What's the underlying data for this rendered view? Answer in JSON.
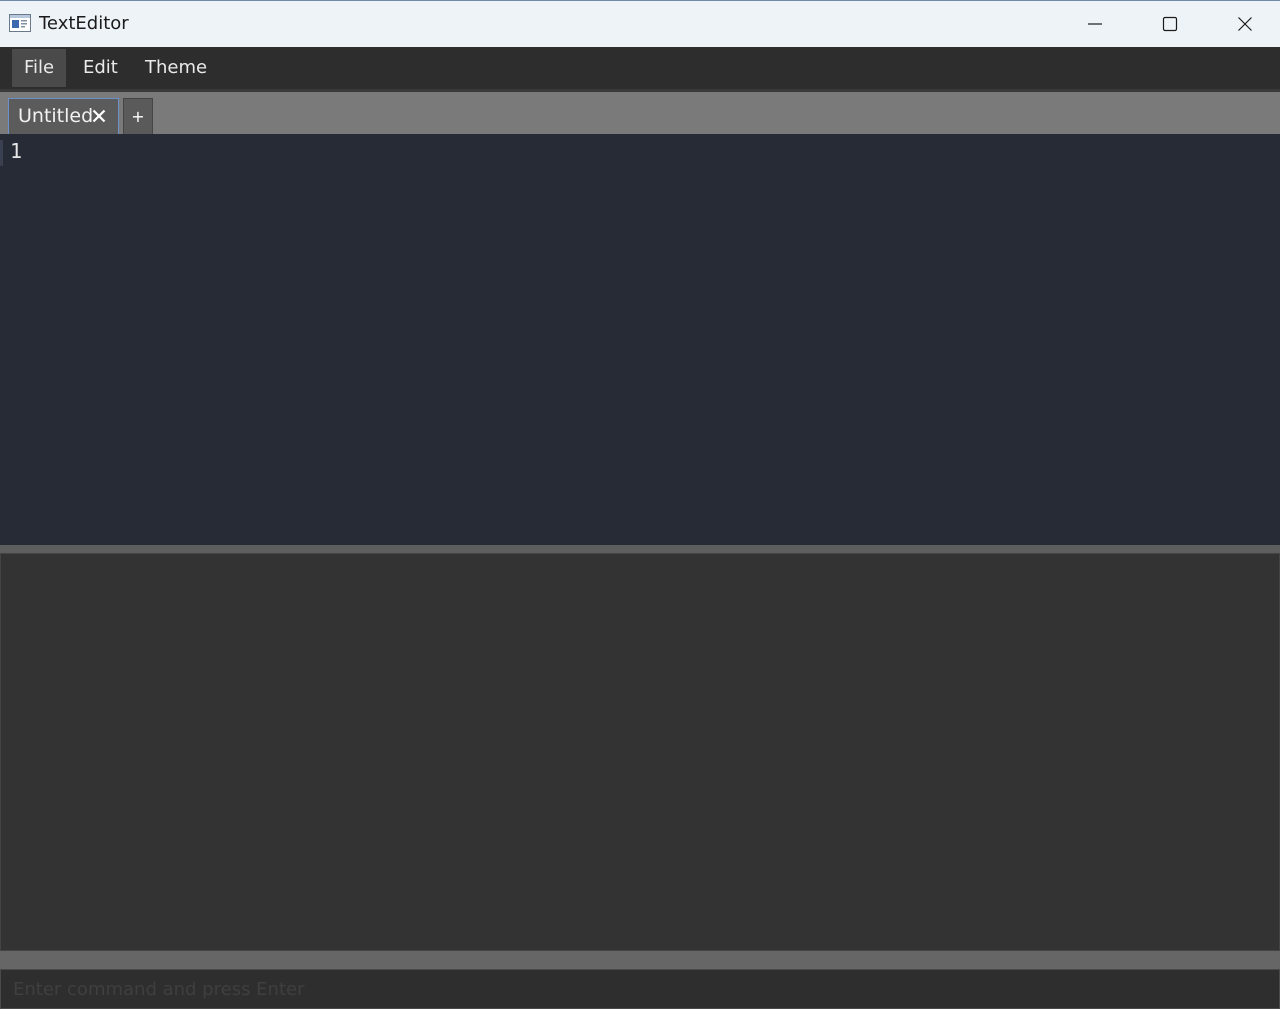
{
  "window": {
    "title": "TextEditor",
    "icon": "app-window-icon",
    "controls": {
      "minimize": "minimize-icon",
      "maximize": "maximize-icon",
      "close": "close-icon"
    }
  },
  "menubar": {
    "items": [
      {
        "label": "File",
        "active": true
      },
      {
        "label": "Edit",
        "active": false
      },
      {
        "label": "Theme",
        "active": false
      }
    ]
  },
  "tabs": {
    "items": [
      {
        "label": "Untitled",
        "active": true,
        "close_icon": "close-icon"
      }
    ],
    "add_label": "+"
  },
  "editor": {
    "line_numbers": [
      "1"
    ],
    "content": ""
  },
  "command": {
    "value": "",
    "placeholder": "Enter command and press Enter"
  },
  "colors": {
    "titlebar": "#eef3f8",
    "menubar": "#2d2d2d",
    "tabstrip": "#7a7a7a",
    "tab_active_border": "#6d90c8",
    "editor_bg": "#272b35",
    "output_bg": "#333333"
  }
}
